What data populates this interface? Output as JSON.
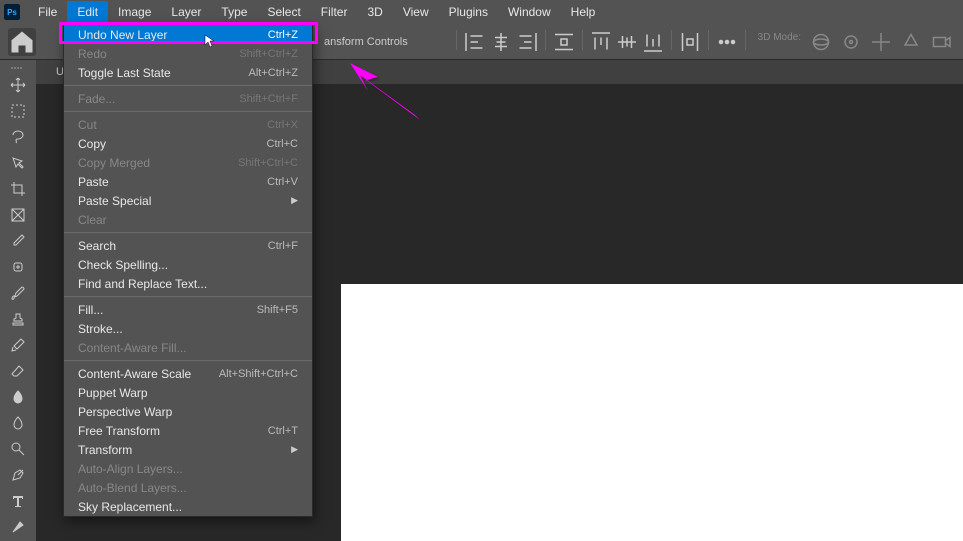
{
  "menubar": {
    "items": [
      "File",
      "Edit",
      "Image",
      "Layer",
      "Type",
      "Select",
      "Filter",
      "3D",
      "View",
      "Plugins",
      "Window",
      "Help"
    ]
  },
  "toolbar": {
    "transform_label": "ansform Controls",
    "mode3d_label": "3D Mode:"
  },
  "tab": {
    "label": "U"
  },
  "edit_menu": [
    {
      "label": "Undo New Layer",
      "shortcut": "Ctrl+Z",
      "highlighted": true
    },
    {
      "label": "Redo",
      "shortcut": "Shift+Ctrl+Z",
      "disabled": true
    },
    {
      "label": "Toggle Last State",
      "shortcut": "Alt+Ctrl+Z"
    },
    {
      "sep": true
    },
    {
      "label": "Fade...",
      "shortcut": "Shift+Ctrl+F",
      "disabled": true
    },
    {
      "sep": true
    },
    {
      "label": "Cut",
      "shortcut": "Ctrl+X",
      "disabled": true
    },
    {
      "label": "Copy",
      "shortcut": "Ctrl+C"
    },
    {
      "label": "Copy Merged",
      "shortcut": "Shift+Ctrl+C",
      "disabled": true
    },
    {
      "label": "Paste",
      "shortcut": "Ctrl+V"
    },
    {
      "label": "Paste Special",
      "submenu": true
    },
    {
      "label": "Clear",
      "disabled": true
    },
    {
      "sep": true
    },
    {
      "label": "Search",
      "shortcut": "Ctrl+F"
    },
    {
      "label": "Check Spelling..."
    },
    {
      "label": "Find and Replace Text..."
    },
    {
      "sep": true
    },
    {
      "label": "Fill...",
      "shortcut": "Shift+F5"
    },
    {
      "label": "Stroke..."
    },
    {
      "label": "Content-Aware Fill...",
      "disabled": true
    },
    {
      "sep": true
    },
    {
      "label": "Content-Aware Scale",
      "shortcut": "Alt+Shift+Ctrl+C"
    },
    {
      "label": "Puppet Warp"
    },
    {
      "label": "Perspective Warp"
    },
    {
      "label": "Free Transform",
      "shortcut": "Ctrl+T"
    },
    {
      "label": "Transform",
      "submenu": true
    },
    {
      "label": "Auto-Align Layers...",
      "disabled": true
    },
    {
      "label": "Auto-Blend Layers...",
      "disabled": true
    },
    {
      "label": "Sky Replacement..."
    }
  ],
  "ps_logo": "Ps"
}
